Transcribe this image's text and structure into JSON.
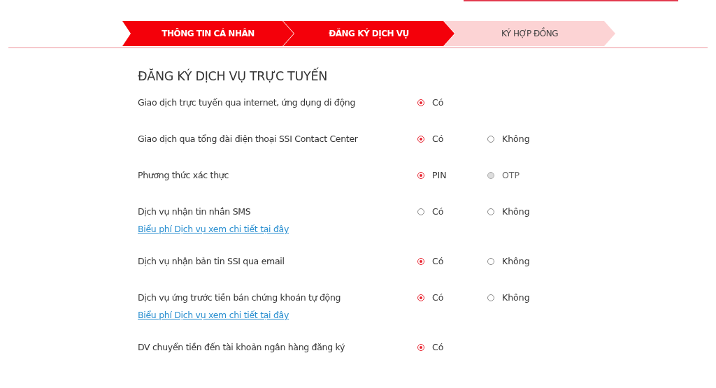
{
  "steps": [
    {
      "label": "THÔNG TIN CÁ NHÂN",
      "active": true
    },
    {
      "label": "ĐĂNG KÝ DỊCH VỤ",
      "active": true
    },
    {
      "label": "KÝ HỢP ĐỒNG",
      "active": false
    }
  ],
  "heading": "ĐĂNG KÝ DỊCH VỤ TRỰC TUYẾN",
  "services": [
    {
      "label": "Giao dịch trực tuyến qua internet, ứng dụng di động",
      "options": [
        {
          "label": "Có",
          "selected": true,
          "disabled": false
        }
      ]
    },
    {
      "label": "Giao dịch qua tổng đài điện thoại SSI Contact Center",
      "options": [
        {
          "label": "Có",
          "selected": true,
          "disabled": false
        },
        {
          "label": "Không",
          "selected": false,
          "disabled": false
        }
      ]
    },
    {
      "label": "Phương thức xác thực",
      "options": [
        {
          "label": "PIN",
          "selected": true,
          "disabled": false
        },
        {
          "label": "OTP",
          "selected": false,
          "disabled": true
        }
      ]
    },
    {
      "label": "Dịch vụ nhận tin nhắn SMS",
      "link": "Biểu phí Dịch vụ xem chi tiết tại đây",
      "options": [
        {
          "label": "Có",
          "selected": false,
          "disabled": false
        },
        {
          "label": "Không",
          "selected": false,
          "disabled": false
        }
      ]
    },
    {
      "label": "Dịch vụ nhận bản tin SSI qua email",
      "options": [
        {
          "label": "Có",
          "selected": true,
          "disabled": false
        },
        {
          "label": "Không",
          "selected": false,
          "disabled": false
        }
      ]
    },
    {
      "label": "Dịch vụ ứng trước tiền bán chứng khoán tự động",
      "link": "Biểu phí Dịch vụ xem chi tiết tại đây",
      "options": [
        {
          "label": "Có",
          "selected": true,
          "disabled": false
        },
        {
          "label": "Không",
          "selected": false,
          "disabled": false
        }
      ]
    },
    {
      "label": "DV chuyển tiền đến tài khoản ngân hàng đăng ký",
      "options": [
        {
          "label": "Có",
          "selected": true,
          "disabled": false
        }
      ]
    }
  ]
}
